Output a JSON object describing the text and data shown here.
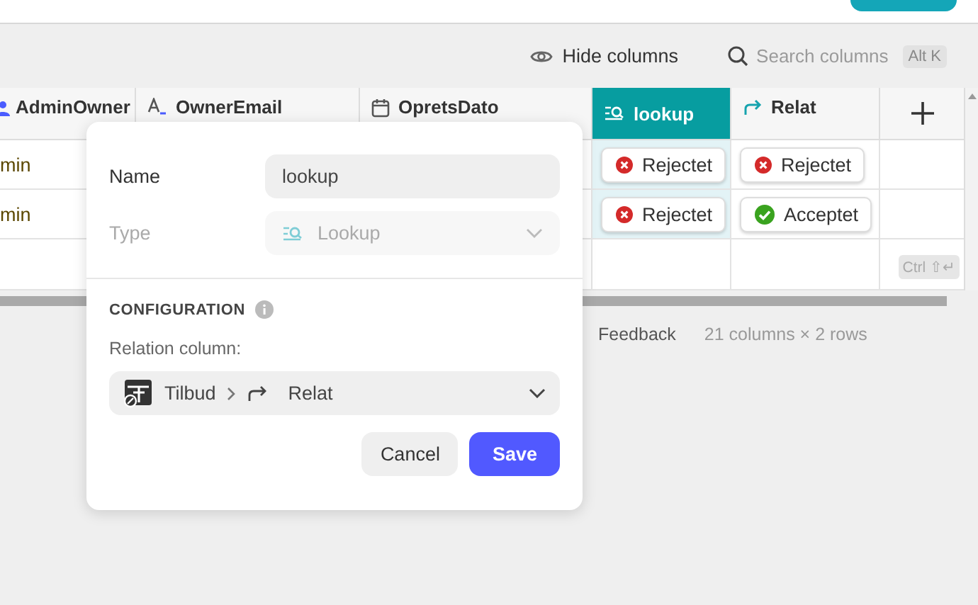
{
  "toolbar": {
    "hide_columns": "Hide columns",
    "search": {
      "placeholder": "Search columns",
      "shortcut": "Alt K"
    }
  },
  "table": {
    "columns": [
      {
        "label": "AdminOwner",
        "kind": "user",
        "selected": false
      },
      {
        "label": "OwnerEmail",
        "kind": "email",
        "selected": false
      },
      {
        "label": "OpretsDato",
        "kind": "date",
        "selected": false
      },
      {
        "label": "lookup",
        "kind": "lookup",
        "selected": true
      },
      {
        "label": "Relat",
        "kind": "relation",
        "selected": false
      }
    ],
    "rows": [
      {
        "admin_owner": "min",
        "lookup": {
          "label": "Rejectet",
          "kind": "rejected"
        },
        "relat": {
          "label": "Rejectet",
          "kind": "rejected"
        }
      },
      {
        "admin_owner": "min",
        "lookup": {
          "label": "Rejectet",
          "kind": "rejected"
        },
        "relat": {
          "label": "Acceptet",
          "kind": "accepted"
        }
      }
    ],
    "add_row_shortcut": "Ctrl ⇧↵"
  },
  "footer": {
    "feedback": "Feedback",
    "summary": "21 columns × 2 rows"
  },
  "dialog": {
    "name_label": "Name",
    "name_value": "lookup",
    "type_label": "Type",
    "type_value": "Lookup",
    "type_disabled": true,
    "section": "CONFIGURATION",
    "relation_label": "Relation column:",
    "relation": {
      "table": "Tilbud",
      "column": "Relat"
    },
    "buttons": [
      {
        "label": "Cancel",
        "kind": "secondary"
      },
      {
        "label": "Save",
        "kind": "primary"
      }
    ]
  }
}
